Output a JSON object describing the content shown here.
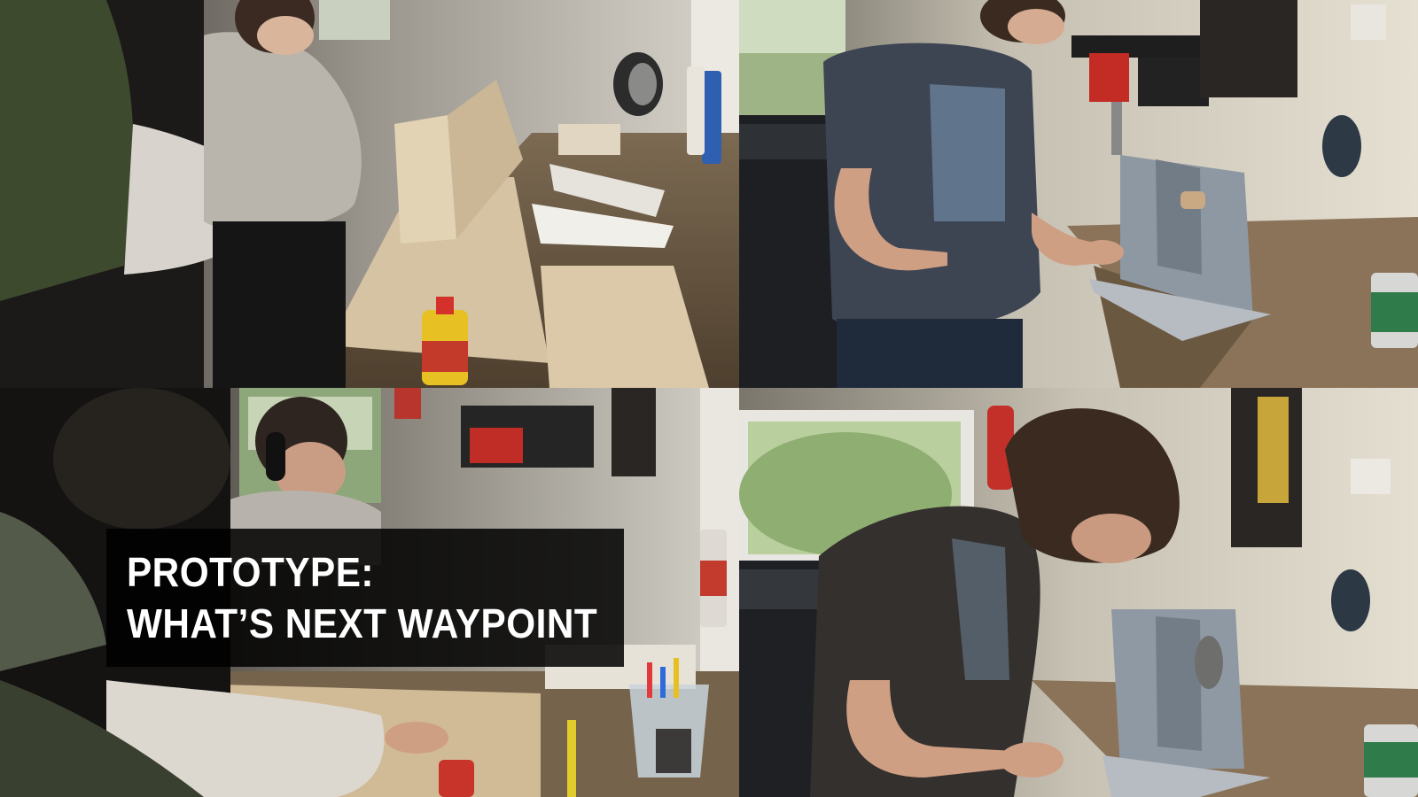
{
  "overlay": {
    "caption_line1": "PROTOTYPE:",
    "caption_line2": "WHAT’S NEXT WAYPOINT"
  },
  "panels": [
    {
      "name": "top-left",
      "subject": "two-people-building-wooden-prototype"
    },
    {
      "name": "top-right",
      "subject": "person-painting-grey-prototype"
    },
    {
      "name": "bottom-left",
      "subject": "people-at-workbench-with-pencils"
    },
    {
      "name": "bottom-right",
      "subject": "person-leaning-over-grey-prototype"
    }
  ],
  "colors": {
    "caption_background": "#000000",
    "caption_text": "#ffffff"
  }
}
